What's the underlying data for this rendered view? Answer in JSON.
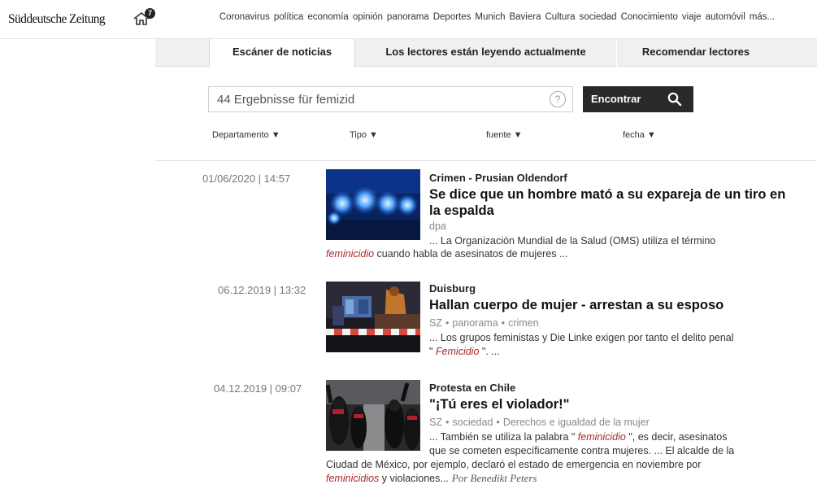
{
  "header": {
    "logo": "Süddeutsche Zeitung",
    "home_badge": "7",
    "nav": [
      "Coronavirus",
      "política",
      "economía",
      "opinión",
      "panorama",
      "Deportes",
      "Munich",
      "Baviera",
      "Cultura",
      "sociedad",
      "Conocimiento",
      "viaje",
      "automóvil",
      "más..."
    ]
  },
  "tabs": [
    {
      "label": "Escáner de noticias",
      "active": true
    },
    {
      "label": "Los lectores están leyendo actualmente",
      "active": false
    },
    {
      "label": "Recomendar lectores",
      "active": false
    }
  ],
  "search": {
    "value": "44 Ergebnisse für femizid",
    "help": "?",
    "button_label": "Encontrar"
  },
  "filters": [
    {
      "label": "Departamento",
      "arrow": "▼"
    },
    {
      "label": "Tipo",
      "arrow": "▼"
    },
    {
      "label": "fuente",
      "arrow": "▼"
    },
    {
      "label": "fecha",
      "arrow": "▼"
    }
  ],
  "articles": [
    {
      "date": "01/06/2020 | 14:57",
      "kicker": "Crimen - Prusian Oldendorf",
      "title_lines": [
        "Se dice que un hombre mató a su expareja de un tiro en",
        "la espalda"
      ],
      "meta": [
        "dpa"
      ],
      "snippet": {
        "l1": "... La Organización Mundial de la Salud (OMS) utiliza el término",
        "l2_hl": "feminicidio",
        "l2_rest": " cuando habla de asesinatos de mujeres ..."
      }
    },
    {
      "date": "06.12.2019 | 13:32",
      "kicker": "Duisburg",
      "title_lines": [
        "Hallan cuerpo de mujer - arrestan a su esposo"
      ],
      "meta": [
        "SZ",
        "panorama",
        "crimen"
      ],
      "snippet": {
        "l1": "... Los grupos feministas y Die Linke exigen por tanto el delito penal",
        "l2_pre": "\" ",
        "l2_hl": "Femicidio",
        "l2_rest": " \". ..."
      }
    },
    {
      "date": "04.12.2019 | 09:07",
      "kicker": "Protesta en Chile",
      "title_lines": [
        "\"¡Tú eres el violador!\""
      ],
      "meta": [
        "SZ",
        "sociedad",
        "Derechos e igualdad de la mujer"
      ],
      "snippet": {
        "l1_pre": "... También se utiliza la palabra \" ",
        "l1_hl": "feminicidio",
        "l1_rest": " \", es decir, asesinatos",
        "l2": "que se cometen específicamente contra mujeres. ... El alcalde de la",
        "l3": "Ciudad de México, por ejemplo, declaró el estado de emergencia en noviembre por",
        "l4_hl": "feminicidios",
        "l4_rest": " y violaciones...",
        "author": "Por Benedikt Peters"
      }
    }
  ],
  "colors": {
    "highlight": "#a8292e",
    "button_bg": "#29292b",
    "tab_bg": "#f0f0f0"
  }
}
